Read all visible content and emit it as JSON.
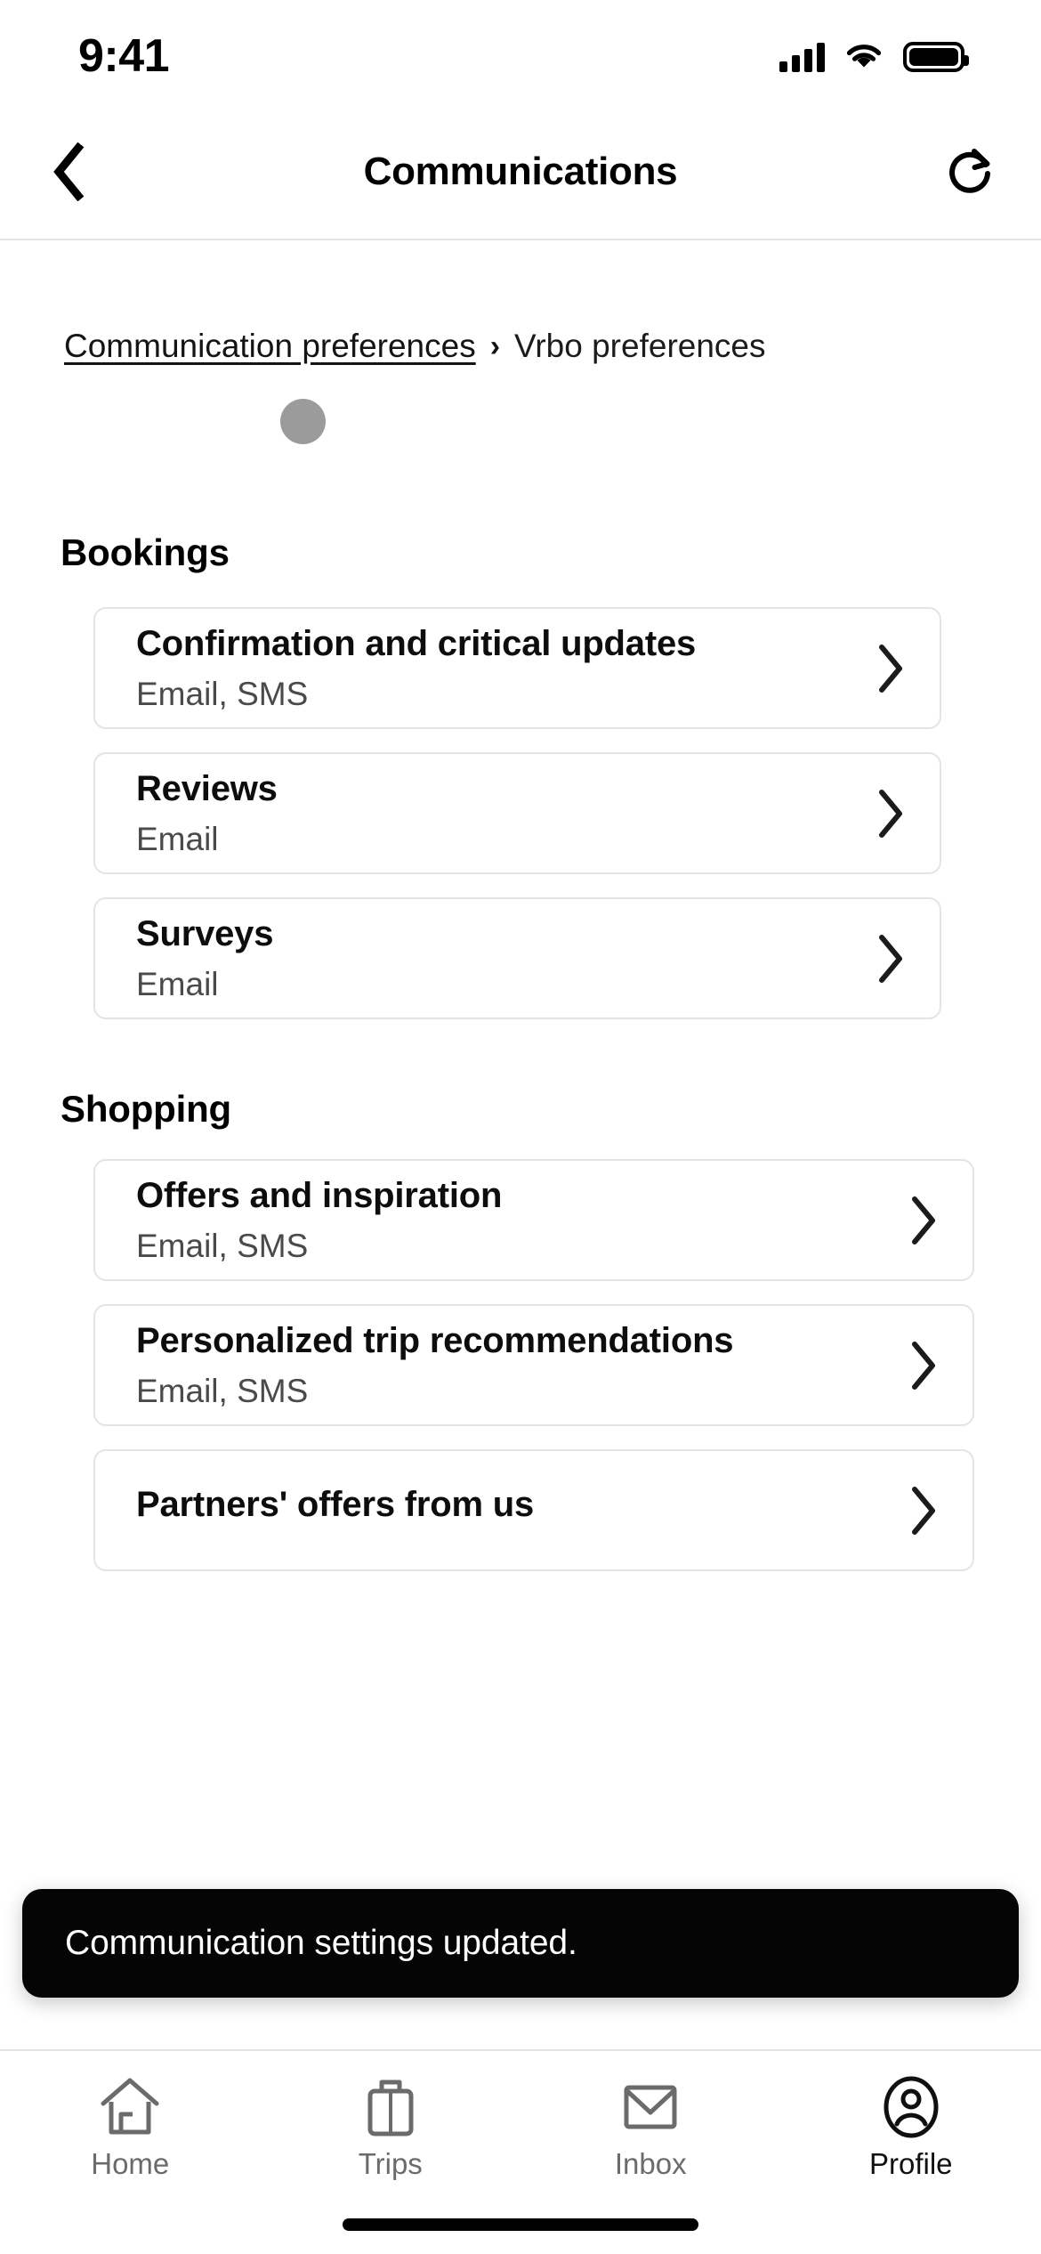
{
  "status_bar": {
    "time": "9:41",
    "cellular_icon": "cellular-signal-icon",
    "wifi_icon": "wifi-icon",
    "battery_icon": "battery-full-icon"
  },
  "nav": {
    "back_icon": "chevron-left-icon",
    "title": "Communications",
    "refresh_icon": "refresh-icon"
  },
  "breadcrumb": {
    "parent_label": "Communication preferences",
    "separator": "›",
    "current_label": "Vrbo preferences"
  },
  "loading_indicator": {
    "name": "loading-dot",
    "color": "#9b9b9b"
  },
  "sections": [
    {
      "id": "bookings",
      "title": "Bookings",
      "cards": [
        {
          "title": "Confirmation and critical updates",
          "subtitle": "Email, SMS",
          "chevron": "chevron-right-icon"
        },
        {
          "title": "Reviews",
          "subtitle": "Email",
          "chevron": "chevron-right-icon"
        },
        {
          "title": "Surveys",
          "subtitle": "Email",
          "chevron": "chevron-right-icon"
        }
      ]
    },
    {
      "id": "shopping",
      "title": "Shopping",
      "cards": [
        {
          "title": "Offers and inspiration",
          "subtitle": "Email, SMS",
          "chevron": "chevron-right-icon"
        },
        {
          "title": "Personalized trip recommendations",
          "subtitle": "Email, SMS",
          "chevron": "chevron-right-icon"
        },
        {
          "title": "Partners' offers from us",
          "subtitle": "",
          "chevron": "chevron-right-icon"
        }
      ]
    }
  ],
  "toast": {
    "message": "Communication settings updated.",
    "background": "#050505",
    "text_color": "#ffffff"
  },
  "tabbar": {
    "items": [
      {
        "label": "Home",
        "icon": "home-icon",
        "active": false
      },
      {
        "label": "Trips",
        "icon": "suitcase-icon",
        "active": false
      },
      {
        "label": "Inbox",
        "icon": "envelope-icon",
        "active": false
      },
      {
        "label": "Profile",
        "icon": "person-circle-icon",
        "active": true
      }
    ]
  },
  "colors": {
    "card_border": "#e4e4e4",
    "text_primary": "#0d0d0d",
    "text_secondary": "#4a4a4a",
    "tab_inactive": "#6b6b6b",
    "tab_active": "#101010"
  }
}
